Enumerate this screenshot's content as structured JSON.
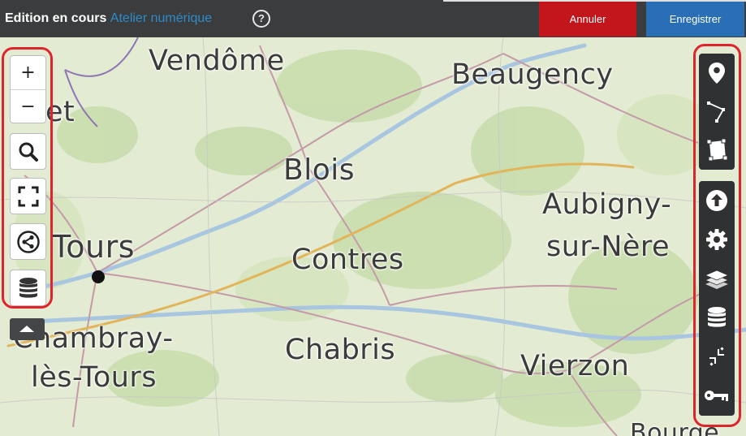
{
  "header": {
    "status": "Edition en cours",
    "map_name": "Atelier numérique",
    "help": "?",
    "cancel_label": "Annuler",
    "save_label": "Enregistrer"
  },
  "colors": {
    "topbar": "#3a3c3d",
    "map_name": "#2e8bc9",
    "cancel": "#c2161c",
    "save": "#2a6fb5",
    "toolbar": "#2f3132",
    "highlight": "#e0242c"
  },
  "map": {
    "places": [
      "Vendôme",
      "Beaugency",
      "et",
      "Blois",
      "Tours",
      "Aubigny-",
      "sur-Nère",
      "Contres",
      "Chambray-",
      "lès-Tours",
      "Chabris",
      "Vierzon",
      "Bourge"
    ]
  },
  "left_controls": {
    "zoom_in": "+",
    "zoom_out": "−",
    "icons": [
      "search-icon",
      "fullscreen-icon",
      "share-icon",
      "database-icon",
      "collapse-up-icon"
    ]
  },
  "right_toolbar": {
    "draw_icons": [
      "marker-icon",
      "polyline-icon",
      "polygon-icon"
    ],
    "tool_icons": [
      "upload-icon",
      "gear-icon",
      "layers-icon",
      "database-icon",
      "shrink-icon",
      "key-icon"
    ]
  }
}
